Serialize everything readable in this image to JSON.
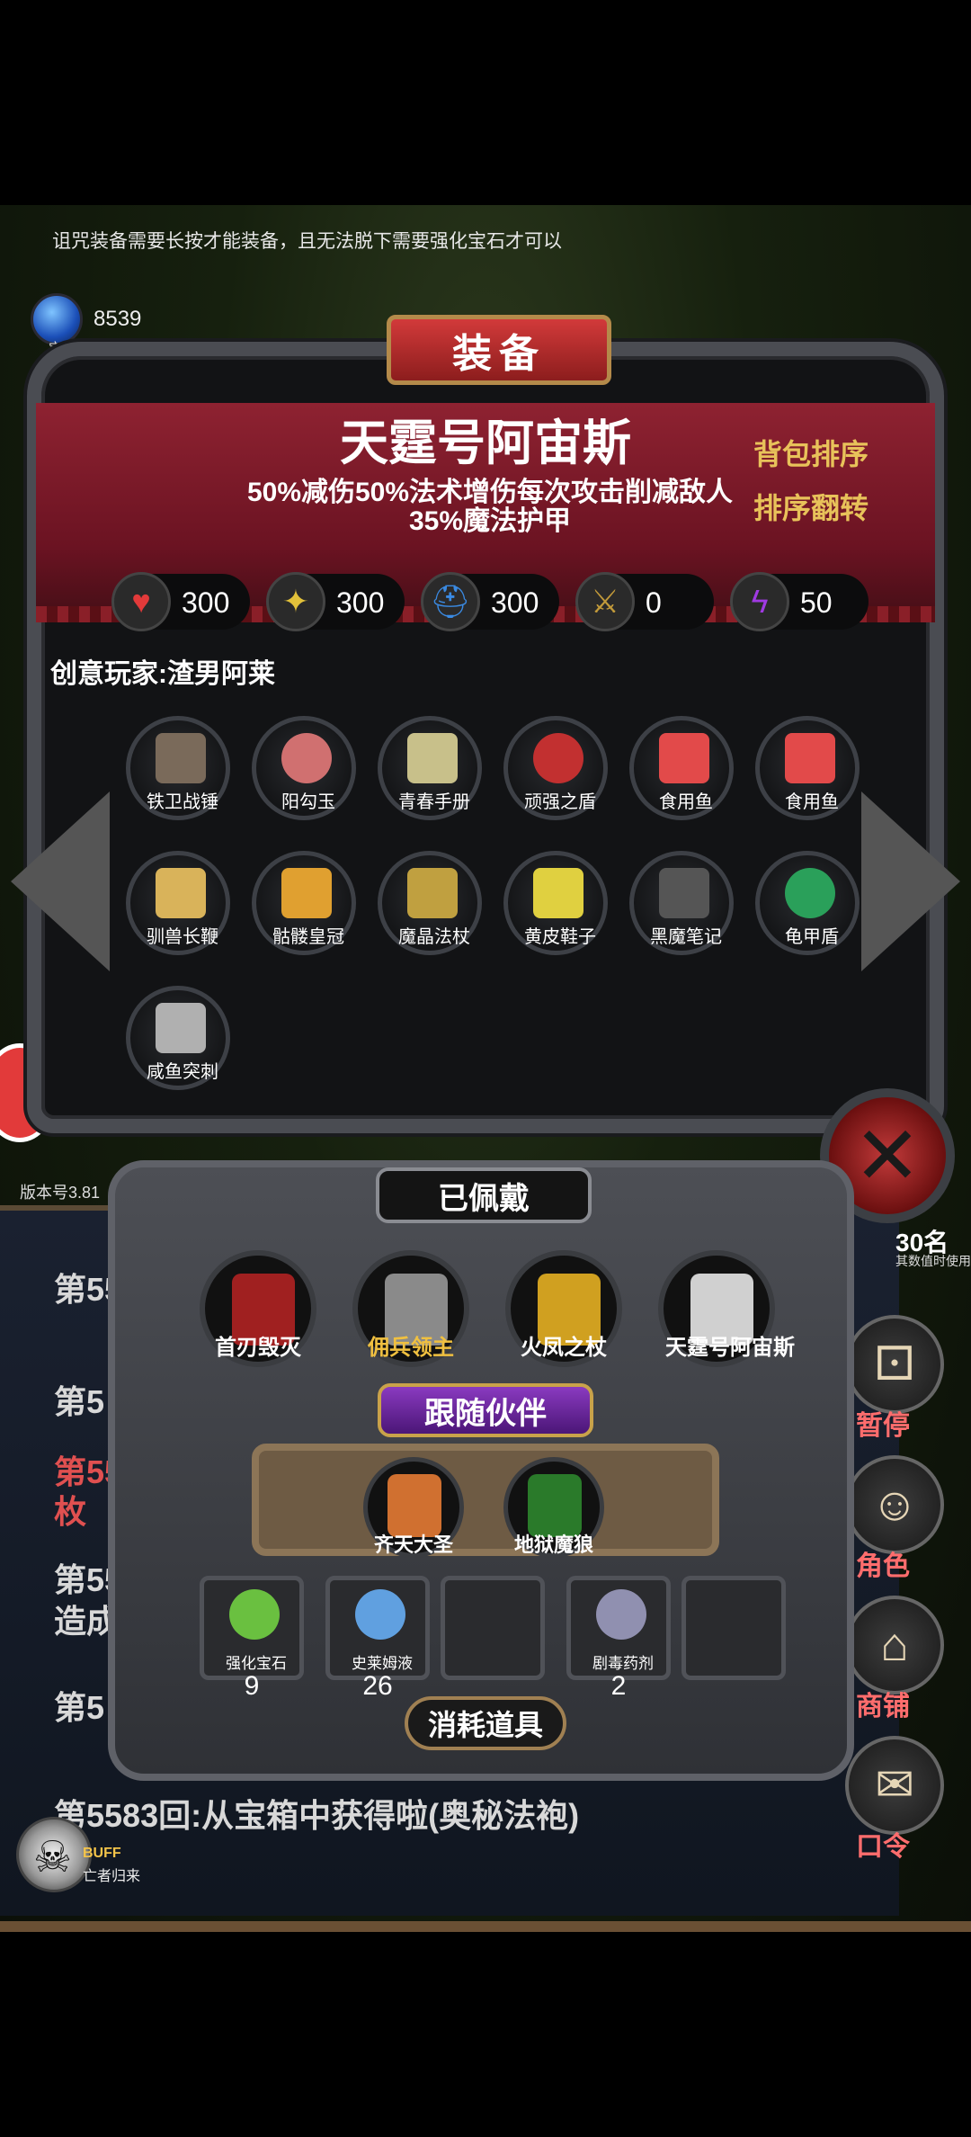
{
  "hint": "诅咒装备需要长按才能装备，且无法脱下需要强化宝石才可以",
  "gem": {
    "count": "8539",
    "label": "宝石",
    "icon": "gem-icon",
    "color": "#3a7ad9"
  },
  "equip": {
    "title": "装备",
    "item_name": "天霆号阿宙斯",
    "item_desc": "50%减伤50%法术增伤每次攻击削减敌人35%魔法护甲",
    "btn_sort": "背包排序",
    "btn_reverse": "排序翻转",
    "stats": [
      {
        "icon": "heart-icon",
        "value": "300",
        "color": "#e23a3a"
      },
      {
        "icon": "strength-icon",
        "value": "300",
        "color": "#e2c13a"
      },
      {
        "icon": "helmet-icon",
        "value": "300",
        "color": "#3a8ae2"
      },
      {
        "icon": "sword-icon",
        "value": "0",
        "color": "#c29a3a"
      },
      {
        "icon": "lightning-icon",
        "value": "50",
        "color": "#a03ae2"
      }
    ],
    "owner": "创意玩家:渣男阿莱",
    "items": [
      {
        "label": "铁卫战锤",
        "color": "#7a6a5a"
      },
      {
        "label": "阳勾玉",
        "color": "#d07070"
      },
      {
        "label": "青春手册",
        "color": "#c8c08a"
      },
      {
        "label": "顽强之盾",
        "color": "#c23030"
      },
      {
        "label": "食用鱼",
        "color": "#e24a4a"
      },
      {
        "label": "食用鱼",
        "color": "#e24a4a"
      },
      {
        "label": "驯兽长鞭",
        "color": "#d9b35a"
      },
      {
        "label": "骷髅皇冠",
        "color": "#e0a030"
      },
      {
        "label": "魔晶法杖",
        "color": "#c0a040"
      },
      {
        "label": "黄皮鞋子",
        "color": "#e0d040"
      },
      {
        "label": "黑魔笔记",
        "color": "#555"
      },
      {
        "label": "龟甲盾",
        "color": "#2aa05a"
      },
      {
        "label": "咸鱼突刺",
        "color": "#b0b0b0"
      }
    ]
  },
  "worn": {
    "title": "已佩戴",
    "items": [
      {
        "label": "首刃毁灭",
        "color": "#a02020",
        "label_color": "#ffffff"
      },
      {
        "label": "佣兵领主",
        "color": "#8a8a8a",
        "label_color": "#f0c040"
      },
      {
        "label": "火凤之杖",
        "color": "#d0a020",
        "label_color": "#ffffff"
      },
      {
        "label": "天霆号阿宙斯",
        "color": "#d0d0d0",
        "label_color": "#ffffff"
      }
    ],
    "companion_title": "跟随伙伴",
    "companions": [
      {
        "label": "齐天大圣",
        "color": "#d07030"
      },
      {
        "label": "地狱魔狼",
        "color": "#2a7a2a"
      }
    ],
    "consumables_title": "消耗道具",
    "consumables": [
      {
        "label": "强化宝石",
        "count": "9",
        "color": "#6ac040"
      },
      {
        "label": "史莱姆液",
        "count": "26",
        "color": "#60a0e0"
      },
      {
        "label": "",
        "count": "",
        "color": ""
      },
      {
        "label": "剧毒药剂",
        "count": "2",
        "color": "#9090b0"
      },
      {
        "label": "",
        "count": "",
        "color": ""
      }
    ]
  },
  "log": {
    "lines": [
      "第55",
      "第5",
      "第55",
      "枚",
      "第55",
      "造成",
      "第5",
      "第5583回:从宝箱中获得啦(奥秘法袍)"
    ]
  },
  "version": "版本号3.81",
  "side": {
    "fragment": "30名",
    "fragment_note": "其数值时使用",
    "buttons": [
      {
        "label": "暂停",
        "icon": "dice-icon"
      },
      {
        "label": "角色",
        "icon": "hood-icon"
      },
      {
        "label": "商铺",
        "icon": "shop-icon"
      },
      {
        "label": "口令",
        "icon": "scroll-icon"
      }
    ]
  },
  "buff": {
    "label": "BUFF",
    "sub": "亡者归来"
  }
}
